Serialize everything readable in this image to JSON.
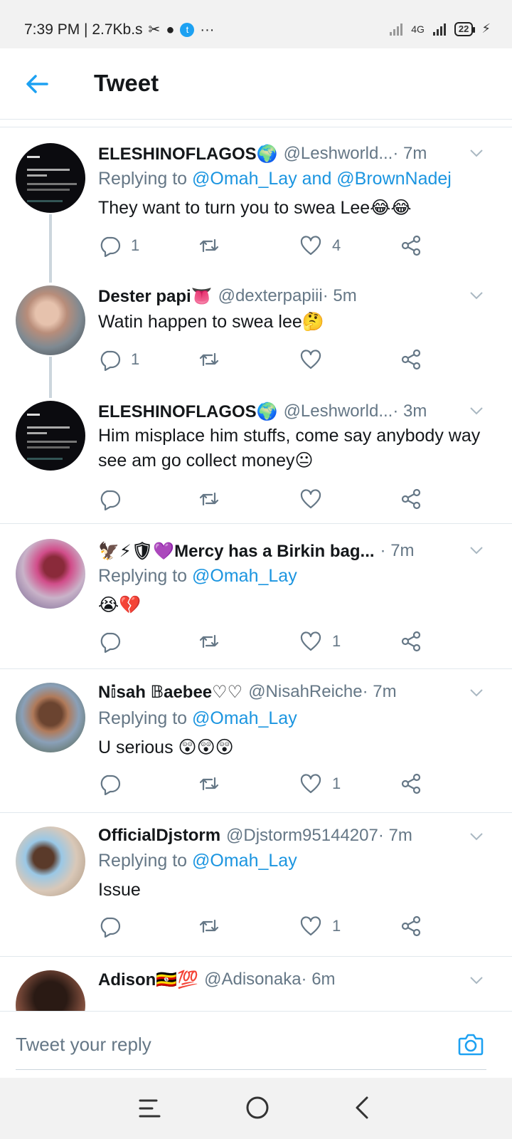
{
  "status_bar": {
    "time_info": "7:39 PM | 2.7Kb.s",
    "network": "4G",
    "battery": "22"
  },
  "header": {
    "title": "Tweet"
  },
  "tweets": [
    {
      "name": "ELESHINOFLAGOS🌍",
      "handle": "@Leshworld...",
      "time": " · 7m",
      "replying_label": "Replying to ",
      "replying_to": "@Omah_Lay and @BrownNadej",
      "text": "They want to turn you to swea Lee😂😂",
      "replies": "1",
      "retweets": "",
      "likes": "4",
      "avatar": "dark-tweet-screenshot-avatar"
    },
    {
      "name": "Dester papi👅",
      "handle": "@dexterpapiii",
      "time": " · 5m",
      "text": "Watin happen to swea lee🤔",
      "replies": "1",
      "retweets": "",
      "likes": "",
      "avatar": "person-avatar"
    },
    {
      "name": "ELESHINOFLAGOS🌍",
      "handle": "@Leshworld...",
      "time": " · 3m",
      "text": "Him misplace him stuffs, come say anybody way see am go collect money😐",
      "replies": "",
      "retweets": "",
      "likes": "",
      "avatar": "dark-tweet-screenshot-avatar"
    },
    {
      "name": "🦅⚡🛡💜Mercy has a Birkin bag...",
      "handle": "",
      "time": " · 7m",
      "replying_label": "Replying to ",
      "replying_to": "@Omah_Lay",
      "text": "😭💔",
      "replies": "",
      "retweets": "",
      "likes": "1",
      "avatar": "person-avatar"
    },
    {
      "name": "N𝕚sah 𝔹aebee♡♡",
      "handle": "@NisahReiche",
      "time": " · 7m",
      "replying_label": "Replying to ",
      "replying_to": "@Omah_Lay",
      "text": "U serious 😲😲😲",
      "replies": "",
      "retweets": "",
      "likes": "1",
      "avatar": "person-avatar"
    },
    {
      "name": "OfficialDjstorm",
      "handle": "@Djstorm95144207",
      "time": " · 7m",
      "replying_label": "Replying to ",
      "replying_to": "@Omah_Lay",
      "text": "Issue",
      "replies": "",
      "retweets": "",
      "likes": "1",
      "avatar": "person-avatar"
    },
    {
      "name": "Adison🇺🇬💯",
      "handle": "@Adisonaka",
      "time": " · 6m",
      "avatar": "person-avatar"
    }
  ],
  "composer": {
    "placeholder": "Tweet your reply"
  },
  "colors": {
    "accent": "#1da1f2",
    "link": "#1b95e0",
    "secondary_text": "#657786",
    "divider": "#e1e8ed"
  }
}
